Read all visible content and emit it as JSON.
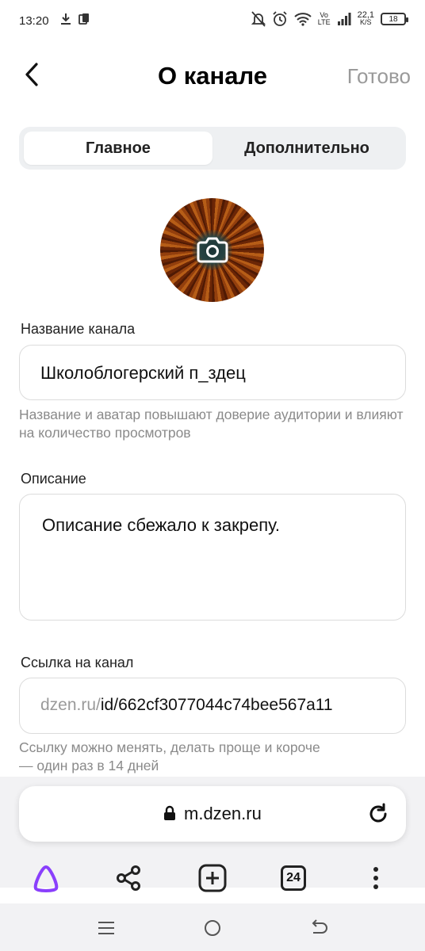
{
  "status_bar": {
    "time": "13:20",
    "network_label_top": "Vo",
    "network_label_bottom": "LTE",
    "speed_value": "22,1",
    "speed_unit": "K/S",
    "battery": "18"
  },
  "header": {
    "title": "О канале",
    "done_label": "Готово"
  },
  "tabs": [
    {
      "label": "Главное",
      "active": true
    },
    {
      "label": "Дополнительно",
      "active": false
    }
  ],
  "channel_name": {
    "label": "Название канала",
    "value": "Школоблогерский п_здец",
    "helper": "Название и аватар повышают доверие аудитории и влияют на количество просмотров"
  },
  "description": {
    "label": "Описание",
    "value": "Описание сбежало к закрепу."
  },
  "channel_link": {
    "label": "Ссылка на канал",
    "prefix": "dzen.ru/",
    "value": "id/662cf3077044c74bee567a11",
    "helper_line1": "Ссылку можно менять, делать проще и короче",
    "helper_line2": "— один раз в 14 дней"
  },
  "browser": {
    "address": "m.dzen.ru",
    "tabs_count": "24"
  },
  "colors": {
    "accent_alice": "#8a3ffc",
    "muted": "#9a9a9a",
    "tab_bg": "#eef0f2"
  }
}
